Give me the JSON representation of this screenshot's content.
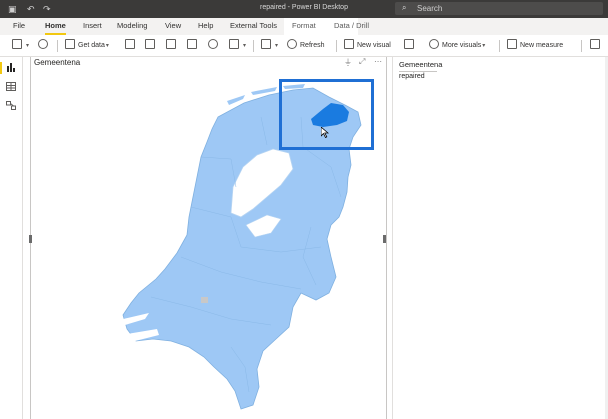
{
  "app": {
    "window_title": "repaired - Power BI Desktop"
  },
  "search": {
    "placeholder": "Search"
  },
  "tabs": [
    {
      "label": "File"
    },
    {
      "label": "Home"
    },
    {
      "label": "Insert"
    },
    {
      "label": "Modeling"
    },
    {
      "label": "View"
    },
    {
      "label": "Help"
    },
    {
      "label": "External Tools"
    },
    {
      "label": "Format"
    },
    {
      "label": "Data / Drill"
    }
  ],
  "active_tab": "Home",
  "ribbon": {
    "get_data": "Get data",
    "refresh": "Refresh",
    "new_visual": "New visual",
    "more_visuals": "More visuals",
    "new_measure": "New measure"
  },
  "visual": {
    "title": "Gemeentena"
  },
  "fields_panel": {
    "header": "Gemeentena",
    "value": "repaired"
  },
  "colors": {
    "titlebar": "#3b3a39",
    "accent_yellow": "#f2c811",
    "map_fill": "#9ec8f5",
    "map_selected": "#1a7be0",
    "highlight_box": "#1f6fd4"
  },
  "icons": [
    "save-icon",
    "undo-icon",
    "redo-icon",
    "search-icon",
    "paste-icon",
    "format-painter-icon",
    "report-view-icon",
    "data-view-icon",
    "model-view-icon",
    "filter-icon",
    "focus-mode-icon",
    "more-options-icon",
    "cursor-icon"
  ]
}
